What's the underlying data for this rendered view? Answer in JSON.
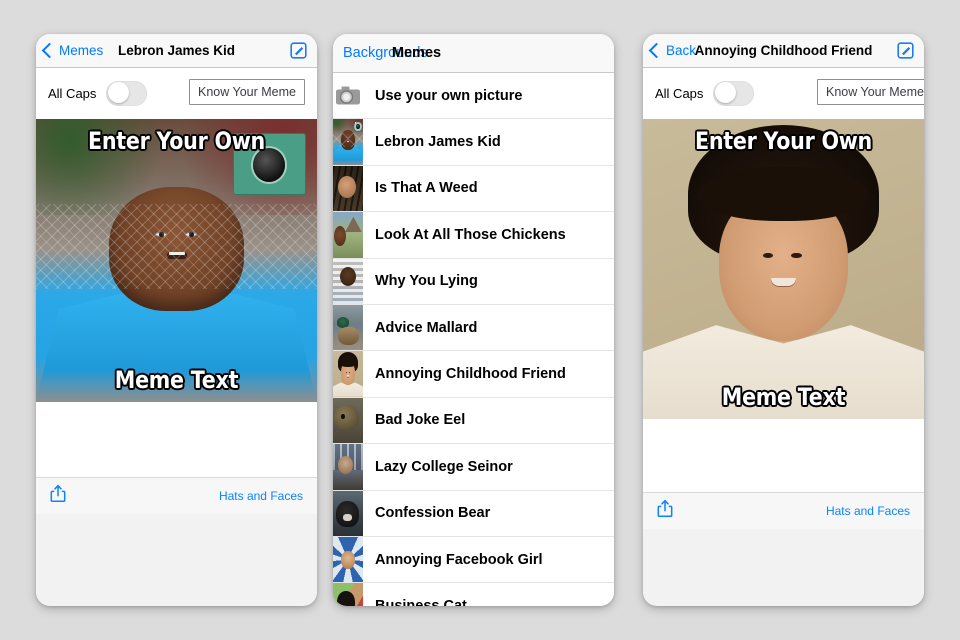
{
  "app": {
    "background_color": "#dcdcdc"
  },
  "panel_left": {
    "nav": {
      "back_label": "Memes",
      "title": "Lebron James Kid",
      "compose_icon": "compose-icon"
    },
    "options": {
      "allcaps_label": "All Caps",
      "allcaps_on": false,
      "know_your_meme_label": "Know Your Meme"
    },
    "meme": {
      "top_text": "Enter Your Own",
      "bottom_text": "Meme Text",
      "watermark": "Know Your Meme"
    },
    "toolbar": {
      "share_icon": "share-icon",
      "hats_and_faces_label": "Hats and Faces"
    }
  },
  "panel_middle": {
    "nav": {
      "back_label": "Backgrounds",
      "title": "Memes"
    },
    "list": [
      {
        "label": "Use your own picture",
        "thumb": "camera-icon"
      },
      {
        "label": "Lebron James Kid",
        "thumb": "lebron-thumb"
      },
      {
        "label": "Is That A Weed",
        "thumb": "weed-thumb"
      },
      {
        "label": "Look At All Those Chickens",
        "thumb": "chickens-thumb"
      },
      {
        "label": "Why You Lying",
        "thumb": "lying-thumb"
      },
      {
        "label": "Advice Mallard",
        "thumb": "mallard-thumb"
      },
      {
        "label": "Annoying Childhood Friend",
        "thumb": "acf-thumb"
      },
      {
        "label": "Bad Joke Eel",
        "thumb": "eel-thumb"
      },
      {
        "label": "Lazy College Seinor",
        "thumb": "lazy-thumb"
      },
      {
        "label": "Confession Bear",
        "thumb": "bear-thumb"
      },
      {
        "label": "Annoying Facebook Girl",
        "thumb": "afg-thumb"
      },
      {
        "label": "Business Cat",
        "thumb": "buscat-thumb"
      }
    ]
  },
  "panel_right": {
    "nav": {
      "back_label": "Back",
      "title": "Annoying Childhood Friend",
      "compose_icon": "compose-icon"
    },
    "options": {
      "allcaps_label": "All Caps",
      "allcaps_on": false,
      "know_your_meme_label": "Know Your Meme"
    },
    "meme": {
      "top_text": "Enter Your Own",
      "bottom_text": "Meme Text"
    },
    "toolbar": {
      "share_icon": "share-icon",
      "hats_and_faces_label": "Hats and Faces"
    }
  },
  "colors": {
    "accent_blue": "#007aff",
    "link_blue": "#0a84ff",
    "nav_bar": "#f8f8f8",
    "separator": "#e4e4e4"
  }
}
